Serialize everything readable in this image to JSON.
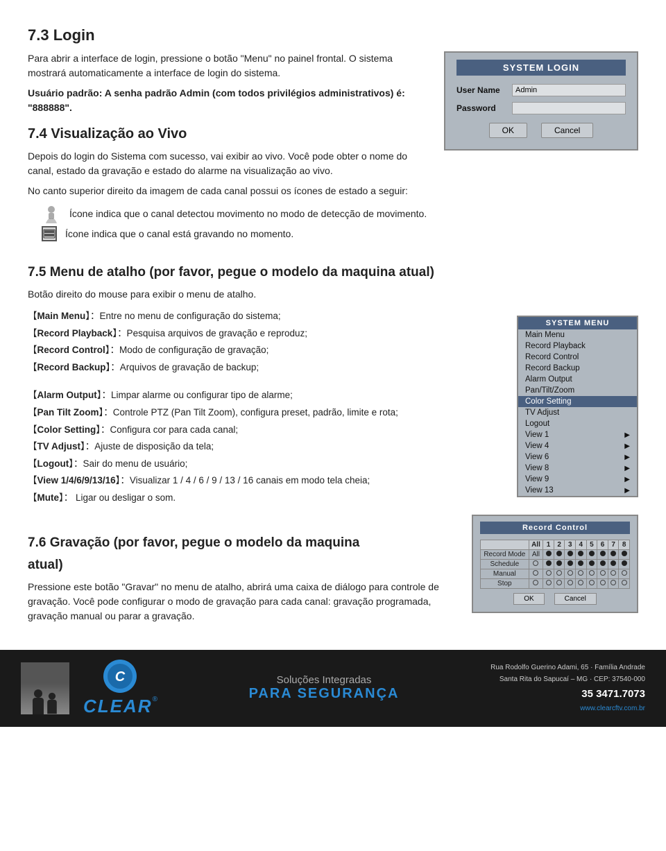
{
  "page": {
    "sections": [
      {
        "id": "section-7-3",
        "heading": "7.3 Login",
        "paragraphs": [
          "Para abrir a interface de login, pressione o botão \"Menu\" no painel frontal. O sistema mostrará automaticamente a interface de login do sistema.",
          "Usuário padrão: A senha padrão Admin (com todos privilégios administrativos) é: \"888888\"."
        ]
      }
    ],
    "login_box": {
      "title": "SYSTEM LOGIN",
      "user_name_label": "User Name",
      "user_name_value": "Admin",
      "password_label": "Password",
      "password_value": "",
      "ok_button": "OK",
      "cancel_button": "Cancel"
    },
    "section_7_4": {
      "heading": "7.4 Visualização ao Vivo",
      "para1": "Depois do login do Sistema com sucesso, vai exibir ao vivo. Você pode obter o nome do canal, estado da gravação e estado do alarme na visualização ao vivo.",
      "para2": "No canto superior direito da imagem de cada canal possui os ícones de estado a seguir:",
      "icon1_text": "Ícone indica que o canal detectou movimento no modo de detecção de movimento.",
      "icon2_text": "Ícone indica que o canal está gravando no momento."
    },
    "section_7_5": {
      "heading": "7.5 Menu de atalho (por favor, pegue o modelo da maquina atual)",
      "para1": "Botão direito do mouse para exibir o menu de atalho.",
      "menu_items": [
        {
          "label": "Main Menu",
          "desc": "Entre no menu de configuração do sistema;"
        },
        {
          "label": "Record Playback",
          "desc": "Pesquisa arquivos de gravação e reproduz;"
        },
        {
          "label": "Record Control",
          "desc": "Modo de configuração de gravação;"
        },
        {
          "label": "Record Backup",
          "desc": "Arquivos de gravação de backup;"
        },
        {
          "label": "Alarm Output",
          "desc": "Limpar alarme ou configurar tipo de alarme;"
        },
        {
          "label": "Pan Tilt Zoom",
          "desc": "Controle PTZ (Pan Tilt Zoom), configura preset, padrão, limite e rota;"
        },
        {
          "label": "Color Setting",
          "desc": "Configura cor para cada canal;"
        },
        {
          "label": "TV Adjust",
          "desc": "Ajuste de disposição da tela;"
        },
        {
          "label": "Logout",
          "desc": "Sair do menu de usuário;"
        },
        {
          "label": "View 1/4/6/9/13/16",
          "desc": "Visualizar 1 / 4 / 6 / 9 / 13 / 16 canais em modo tela cheia;"
        },
        {
          "label": "Mute",
          "desc": "Ligar ou desligar o som."
        }
      ],
      "system_menu": {
        "title": "SYSTEM MENU",
        "items": [
          {
            "label": "Main Menu",
            "highlighted": false
          },
          {
            "label": "Record Playback",
            "highlighted": false
          },
          {
            "label": "Record Control",
            "highlighted": false
          },
          {
            "label": "Record Backup",
            "highlighted": false
          },
          {
            "label": "Alarm Output",
            "highlighted": false
          },
          {
            "label": "Pan/Tilt/Zoom",
            "highlighted": false
          },
          {
            "label": "Color Setting",
            "highlighted": true
          },
          {
            "label": "TV Adjust",
            "highlighted": false
          },
          {
            "label": "Logout",
            "highlighted": false
          },
          {
            "label": "View 1",
            "has_arrow": true
          },
          {
            "label": "View 4",
            "has_arrow": true
          },
          {
            "label": "View 6",
            "has_arrow": true
          },
          {
            "label": "View 8",
            "has_arrow": true
          },
          {
            "label": "View 9",
            "has_arrow": true
          },
          {
            "label": "View 13",
            "has_arrow": true
          }
        ]
      }
    },
    "section_7_6": {
      "heading1": "7.6 Gravação (por favor, pegue o modelo da maquina",
      "heading2": "atual)",
      "para1": "Pressione este botão \"Gravar\" no menu de atalho, abrirá uma caixa de diálogo para controle de gravação. Você pode configurar o modo de gravação para cada canal: gravação programada, gravação manual ou parar a gravação.",
      "record_box": {
        "title": "Record Control",
        "columns": [
          "",
          "All",
          "1",
          "2",
          "3",
          "4",
          "5",
          "6",
          "7",
          "8"
        ],
        "rows": [
          {
            "label": "Record Mode",
            "all": "All",
            "values": [
              "filled",
              "filled",
              "filled",
              "filled",
              "filled",
              "filled",
              "filled",
              "filled"
            ]
          },
          {
            "label": "Schedule",
            "all": "empty",
            "values": [
              "filled",
              "filled",
              "filled",
              "filled",
              "filled",
              "filled",
              "filled",
              "filled"
            ]
          },
          {
            "label": "Manual",
            "all": "empty",
            "values": [
              "empty",
              "empty",
              "empty",
              "empty",
              "empty",
              "empty",
              "empty",
              "empty"
            ]
          },
          {
            "label": "Stop",
            "all": "empty",
            "values": [
              "empty",
              "empty",
              "empty",
              "empty",
              "empty",
              "empty",
              "empty",
              "empty"
            ]
          }
        ],
        "ok_button": "OK",
        "cancel_button": "Cancel"
      }
    },
    "footer": {
      "people_alt": "business people",
      "logo_letter": "C",
      "brand_name": "CLEAR",
      "registered": "®",
      "slogan_line1": "Soluções Integradas",
      "slogan_line2": "para SEGURANÇA",
      "address": "Rua Rodolfo Guerino Adami, 65 · Família Andrade",
      "city": "Santa Rita do Sapucaí – MG · CEP: 37540-000",
      "phone_label": "35 3471.7073",
      "website": "www.clearcftv.com.br"
    }
  }
}
